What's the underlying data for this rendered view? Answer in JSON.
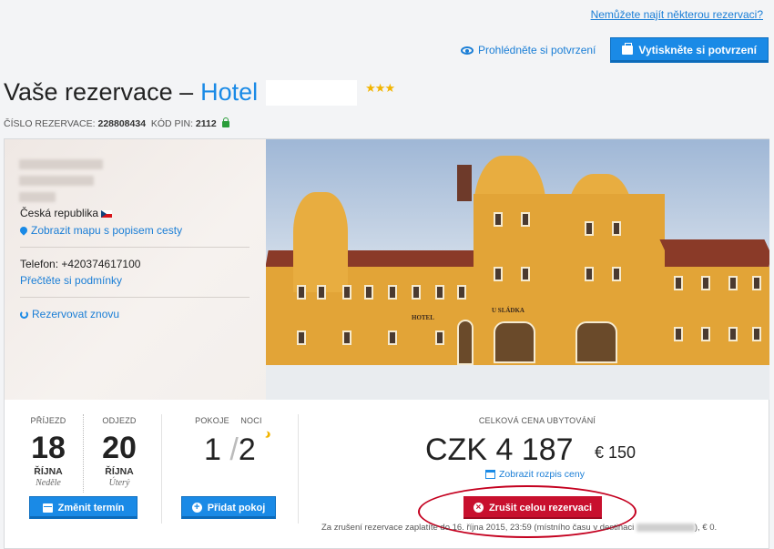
{
  "header": {
    "help_link": "Nemůžete najít některou rezervaci?",
    "view_confirmation": "Prohlédněte si potvrzení",
    "print_confirmation": "Vytiskněte si potvrzení"
  },
  "title": {
    "prefix": "Vaše rezervace –",
    "hotel_word": "Hotel",
    "stars": "★★★"
  },
  "booking": {
    "number_label": "ČÍSLO REZERVACE:",
    "number_value": "228808434",
    "pin_label": "KÓD PIN:",
    "pin_value": "2112"
  },
  "hotel_info": {
    "country": "Česká republika",
    "map_link": "Zobrazit mapu s popisem cesty",
    "phone": "Telefon: +420374617100",
    "conditions_link": "Přečtěte si podmínky",
    "rebook_link": "Rezervovat znovu"
  },
  "photo": {
    "sign_hotel": "HOTEL",
    "sign_name": "U SLÁDKA"
  },
  "stay": {
    "arrival_label": "PŘÍJEZD",
    "arrival_day": "18",
    "arrival_month": "ŘÍJNA",
    "arrival_weekday": "Neděle",
    "departure_label": "ODJEZD",
    "departure_day": "20",
    "departure_month": "ŘÍJNA",
    "departure_weekday": "Úterý",
    "change_button": "Změnit termín",
    "rooms_label": "POKOJE",
    "nights_label": "NOCI",
    "rooms_value": "1",
    "separator": "/",
    "nights_value": "2",
    "add_room_button": "Přidat pokoj"
  },
  "price": {
    "label": "CELKOVÁ CENA UBYTOVÁNÍ",
    "czk": "CZK 4 187",
    "eur": "€ 150",
    "breakdown_link": "Zobrazit rozpis ceny",
    "cancel_button": "Zrušit celou rezervaci",
    "note_prefix": "Za zrušení rezervace zaplatíte do 16. října 2015, 23:59 (místního času v destinaci",
    "note_suffix": "), € 0."
  },
  "colors": {
    "accent": "#1a8ae6",
    "danger": "#c8102e",
    "star": "#f2b400",
    "lock": "#2a9d3a"
  },
  "icons": [
    "eye-icon",
    "printer-icon",
    "lock-icon",
    "map-pin-icon",
    "refresh-icon",
    "calendar-icon",
    "plus-circle-icon",
    "moon-icon",
    "price-breakdown-icon",
    "close-circle-icon",
    "czech-flag-icon"
  ]
}
